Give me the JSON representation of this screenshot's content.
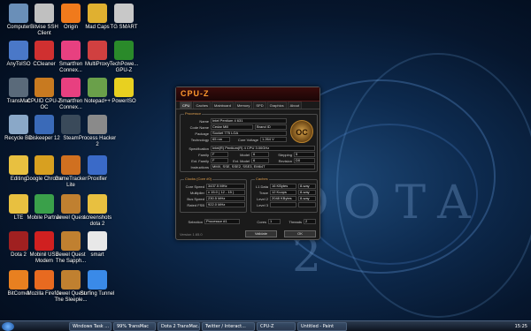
{
  "desktop": {
    "watermark": "DOTA 2",
    "icons": [
      {
        "label": "Computer",
        "color": "#6a8fb8"
      },
      {
        "label": "Bitvise SSH Client",
        "color": "#c0c0c0"
      },
      {
        "label": "Origin",
        "color": "#f07a1c"
      },
      {
        "label": "Mad Caps",
        "color": "#e0b030"
      },
      {
        "label": "TG SMART",
        "color": "#c8c8c8"
      },
      {
        "label": "AnyToISO",
        "color": "#4a78c8"
      },
      {
        "label": "CCleaner",
        "color": "#d03030"
      },
      {
        "label": "Smartfren Connex...",
        "color": "#e84080"
      },
      {
        "label": "MultiProxy",
        "color": "#d04040"
      },
      {
        "label": "TechPowe... GPU-Z",
        "color": "#2a8a2a"
      },
      {
        "label": "TransMac",
        "color": "#5a6a7a"
      },
      {
        "label": "CPUID CPU-Z OC",
        "color": "#c87a20"
      },
      {
        "label": "Smartfren Connex...",
        "color": "#e84080"
      },
      {
        "label": "Notepad++",
        "color": "#6aa04a"
      },
      {
        "label": "PowerISO",
        "color": "#e8d020"
      },
      {
        "label": "Recycle Bin",
        "color": "#8aa8c8"
      },
      {
        "label": "Diskeeper 12",
        "color": "#3a6ab8"
      },
      {
        "label": "Steam",
        "color": "#3a4a5a"
      },
      {
        "label": "Process Hacker 2",
        "color": "#8a8a8a"
      },
      {
        "label": "Editing",
        "color": "#e8c040"
      },
      {
        "label": "Google Chrome",
        "color": "#d8a020"
      },
      {
        "label": "GameTracker Lite",
        "color": "#d07020"
      },
      {
        "label": "Proxifier",
        "color": "#3a6ac8"
      },
      {
        "label": "LTE",
        "color": "#e8c040"
      },
      {
        "label": "Mobile Partner",
        "color": "#3aa04a"
      },
      {
        "label": "Jewel Quest",
        "color": "#c08030"
      },
      {
        "label": "screenshots dota 2",
        "color": "#e8c040"
      },
      {
        "label": "Dota 2",
        "color": "#a02020"
      },
      {
        "label": "Mobinil USB Modem",
        "color": "#d02020"
      },
      {
        "label": "Jewel Quest The Sapph...",
        "color": "#c08030"
      },
      {
        "label": "smart",
        "color": "#e8e8e8"
      },
      {
        "label": "BitComet",
        "color": "#e88020"
      },
      {
        "label": "Mozilla Firefox",
        "color": "#e86a20"
      },
      {
        "label": "Jewel Quest The Sleeple...",
        "color": "#c08030"
      },
      {
        "label": "Surfing Tunnel",
        "color": "#3a8ae8"
      }
    ]
  },
  "cpuz": {
    "title": "CPU-Z",
    "tabs": [
      "CPU",
      "Caches",
      "Mainboard",
      "Memory",
      "SPD",
      "Graphics",
      "About"
    ],
    "processor_group": "Processor",
    "labels": {
      "name": "Name",
      "code_name": "Code Name",
      "package": "Package",
      "technology": "Technology",
      "core_voltage": "Core Voltage",
      "specification": "Specification",
      "family": "Family",
      "model": "Model",
      "stepping": "Stepping",
      "ext_family": "Ext. Family",
      "ext_model": "Ext. Model",
      "revision": "Revision",
      "instructions": "Instructions",
      "brand_id": "Brand ID"
    },
    "values": {
      "name": "Intel Pentium 4 631",
      "code_name": "Cedar Mill",
      "brand_id": "Brand ID",
      "package": "Socket 775 LGA",
      "technology": "65 nm",
      "core_voltage": "1.264 V",
      "specification": "Intel(R) Pentium(R) 4 CPU 3.00GHz",
      "family": "F",
      "model": "6",
      "stepping": "5",
      "ext_family": "F",
      "ext_model": "6",
      "revision": "D0",
      "instructions": "MMX, SSE, SSE2, SSE3, EM64T"
    },
    "clocks_group": "Clocks (Core #0)",
    "clocks": [
      {
        "label": "Core Speed",
        "value": "3437.5 MHz"
      },
      {
        "label": "Multiplier",
        "value": "x 15.0 ( 12 - 15 )"
      },
      {
        "label": "Bus Speed",
        "value": "230.5 MHz"
      },
      {
        "label": "Rated FSB",
        "value": "922.0 MHz"
      }
    ],
    "caches_group": "Caches",
    "caches": [
      {
        "label": "L1 Data",
        "size": "16 KBytes",
        "ways": "8-way"
      },
      {
        "label": "Trace",
        "size": "12 Kuops",
        "ways": "8-way"
      },
      {
        "label": "Level 2",
        "size": "2048 KBytes",
        "ways": "8-way"
      },
      {
        "label": "Level 3",
        "size": "",
        "ways": ""
      }
    ],
    "selection_label": "Selection",
    "selection_value": "Processor #1",
    "cores_label": "Cores",
    "cores_value": "1",
    "threads_label": "Threads",
    "threads_value": "2",
    "version": "Version 1.65.0",
    "validate": "Validate",
    "ok": "OK",
    "logo": "OC"
  },
  "taskbar": {
    "items": [
      "Windows Task ...",
      "99% TransMac",
      "Dota 2 TransMac...",
      "Twitter / Interact...",
      "CPU-Z",
      "Untitled - Paint"
    ],
    "clock": "15:25"
  }
}
